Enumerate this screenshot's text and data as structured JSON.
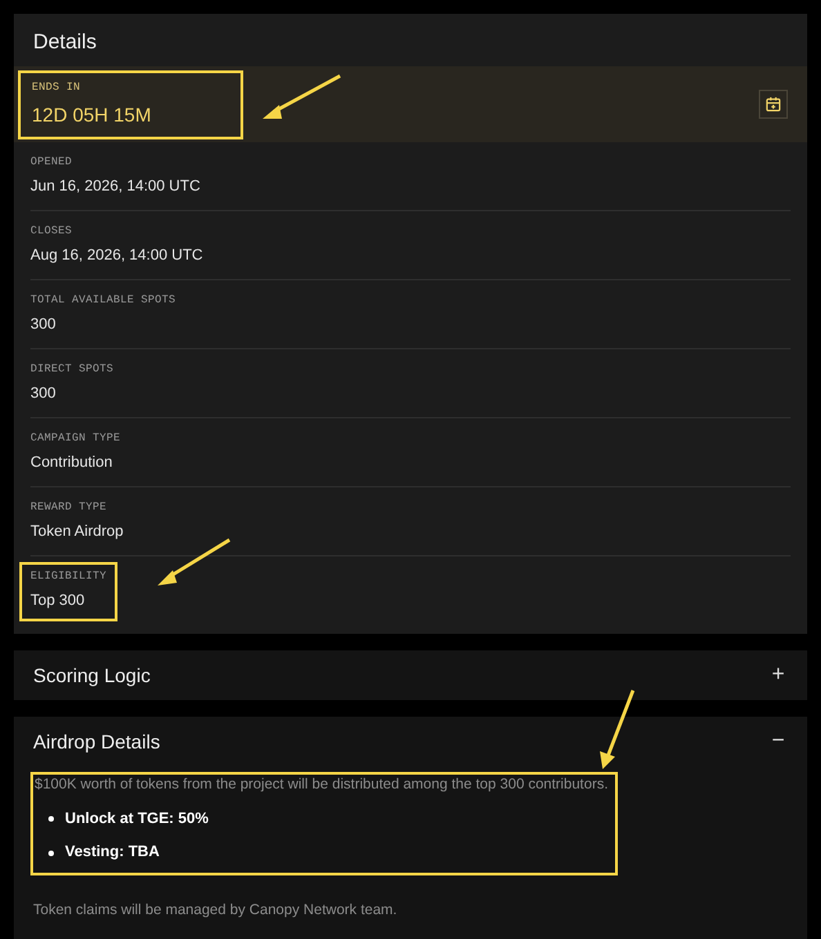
{
  "details": {
    "title": "Details",
    "countdown": {
      "label": "ENDS IN",
      "value": "12D 05H 15M",
      "highlighted": true
    },
    "rows": [
      {
        "label": "OPENED",
        "value": "Jun 16, 2026, 14:00 UTC",
        "highlighted": false
      },
      {
        "label": "CLOSES",
        "value": "Aug 16, 2026, 14:00 UTC",
        "highlighted": false
      },
      {
        "label": "TOTAL AVAILABLE SPOTS",
        "value": "300",
        "highlighted": false
      },
      {
        "label": "DIRECT SPOTS",
        "value": "300",
        "highlighted": false
      },
      {
        "label": "CAMPAIGN TYPE",
        "value": "Contribution",
        "highlighted": false
      },
      {
        "label": "REWARD TYPE",
        "value": "Token Airdrop",
        "highlighted": false
      },
      {
        "label": "ELIGIBILITY",
        "value": "Top 300",
        "highlighted": true
      }
    ]
  },
  "sections": [
    {
      "title": "Scoring Logic",
      "toggle": "+",
      "expanded": false
    },
    {
      "title": "Airdrop Details",
      "toggle": "−",
      "expanded": true,
      "intro": "$100K worth of tokens from the project will be distributed among the top 300 contributors.",
      "bullets": [
        "Unlock at TGE: 50%",
        "Vesting: TBA"
      ],
      "highlighted": true,
      "footer": "Token claims will be managed by Canopy Network team."
    }
  ]
}
